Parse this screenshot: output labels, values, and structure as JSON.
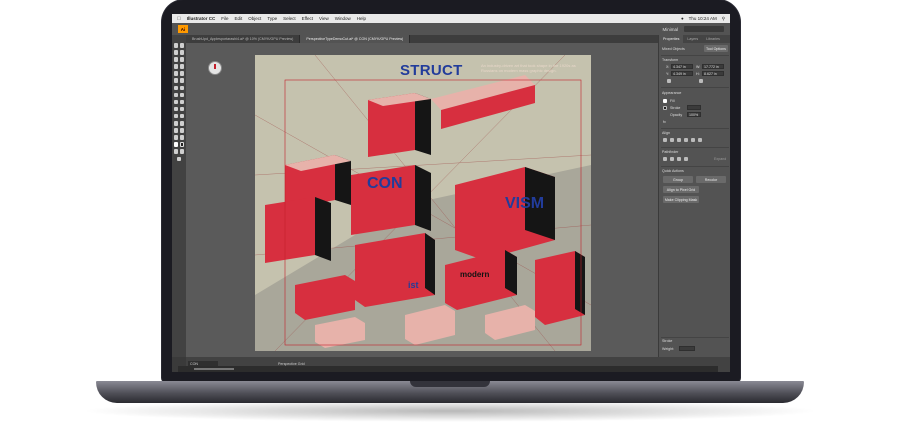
{
  "menubar": {
    "apple": "",
    "app_name": "Illustrator CC",
    "items": [
      "File",
      "Edit",
      "Object",
      "Type",
      "Select",
      "Effect",
      "View",
      "Window",
      "Help"
    ],
    "clock": "Thu 10:24 AM"
  },
  "appbar": {
    "logo": "Ai",
    "workspace": "Minimal"
  },
  "tabs": [
    {
      "label": "BrushUpd_Applesportarashi4.ai* @ 10% (CMYK/GPU Preview)",
      "active": false
    },
    {
      "label": "PerspectiveTypeDemoCut.ai* @ CON (CMYK/GPU Preview)",
      "active": true
    }
  ],
  "artwork": {
    "title": "STRUCT",
    "subtitle": "An industry-driven art that took shape in the 1920s as Russians on modern mass graphic design.",
    "word_con": "CON",
    "word_vism": "VISM",
    "word_mid": "ist",
    "word_dark": "modern"
  },
  "panels": {
    "tabs": [
      "Properties",
      "Layers",
      "Libraries"
    ],
    "selection": "Mixed Objects",
    "tool_options": "Tool Options",
    "transform": "Transform",
    "x_label": "X:",
    "x_value": "4.347 in",
    "y_label": "Y:",
    "y_value": "4.349 in",
    "w_label": "W:",
    "w_value": "17.772 in",
    "h_label": "H:",
    "h_value": "8.627 in",
    "appearance": "Appearance",
    "fill": "Fill",
    "stroke": "Stroke",
    "opacity": "Opacity",
    "opacity_value": "100%",
    "fx": "fx",
    "align": "Align",
    "pathfinder": "Pathfinder",
    "expand": "Expand",
    "quick_actions": "Quick Actions",
    "group": "Group",
    "recolor": "Recolor",
    "align_pixel": "Align to Pixel Grid",
    "clipping_mask": "Make Clipping Mask",
    "stroke_panel": "Stroke",
    "weight": "Weight:"
  },
  "status": {
    "zoom": "CON",
    "tool": "Perspective Grid",
    "duration": "Duration: 31 secs"
  },
  "colors": {
    "bezel": "#1b1b22",
    "ui_dark": "#3a3a3a",
    "artboard": "#c5c2ae",
    "block_red": "#d72f3f",
    "title_blue": "#223c9b",
    "ai_orange": "#ff9a00"
  }
}
